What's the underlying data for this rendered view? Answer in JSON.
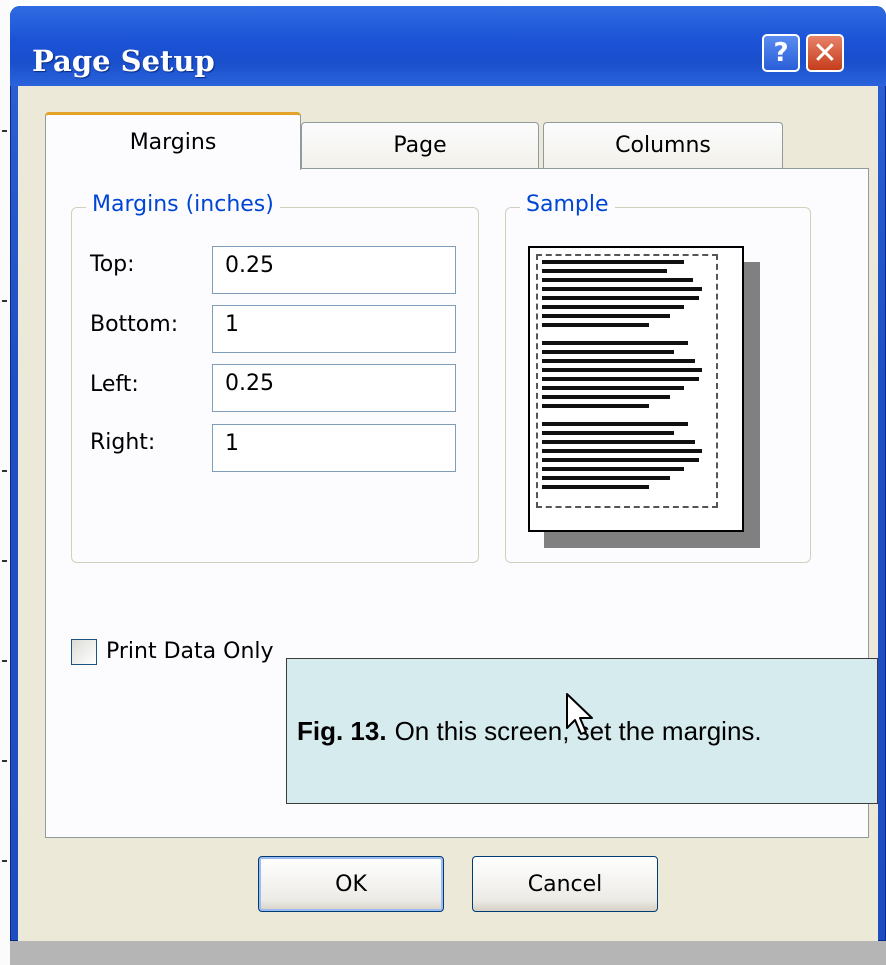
{
  "window": {
    "title": "Page Setup",
    "help_glyph": "?",
    "close_glyph": "✕",
    "titlebar_color": "#1f55d3",
    "body_color": "#ece9d8"
  },
  "tabs": [
    {
      "label": "Margins",
      "active": true
    },
    {
      "label": "Page",
      "active": false
    },
    {
      "label": "Columns",
      "active": false
    }
  ],
  "margins": {
    "group_label": "Margins (inches)",
    "fields": [
      {
        "label": "Top:",
        "value": "0.25"
      },
      {
        "label": "Bottom:",
        "value": "1"
      },
      {
        "label": "Left:",
        "value": "0.25"
      },
      {
        "label": "Right:",
        "value": "1"
      }
    ]
  },
  "sample": {
    "group_label": "Sample"
  },
  "print_data_only": {
    "label": "Print Data Only",
    "checked": false
  },
  "caption": {
    "fig": "Fig. 13.",
    "text": "On this screen, set the margins."
  },
  "buttons": {
    "ok": "OK",
    "cancel": "Cancel"
  },
  "icons": [
    "help-icon",
    "close-icon",
    "mouse-cursor-icon"
  ]
}
